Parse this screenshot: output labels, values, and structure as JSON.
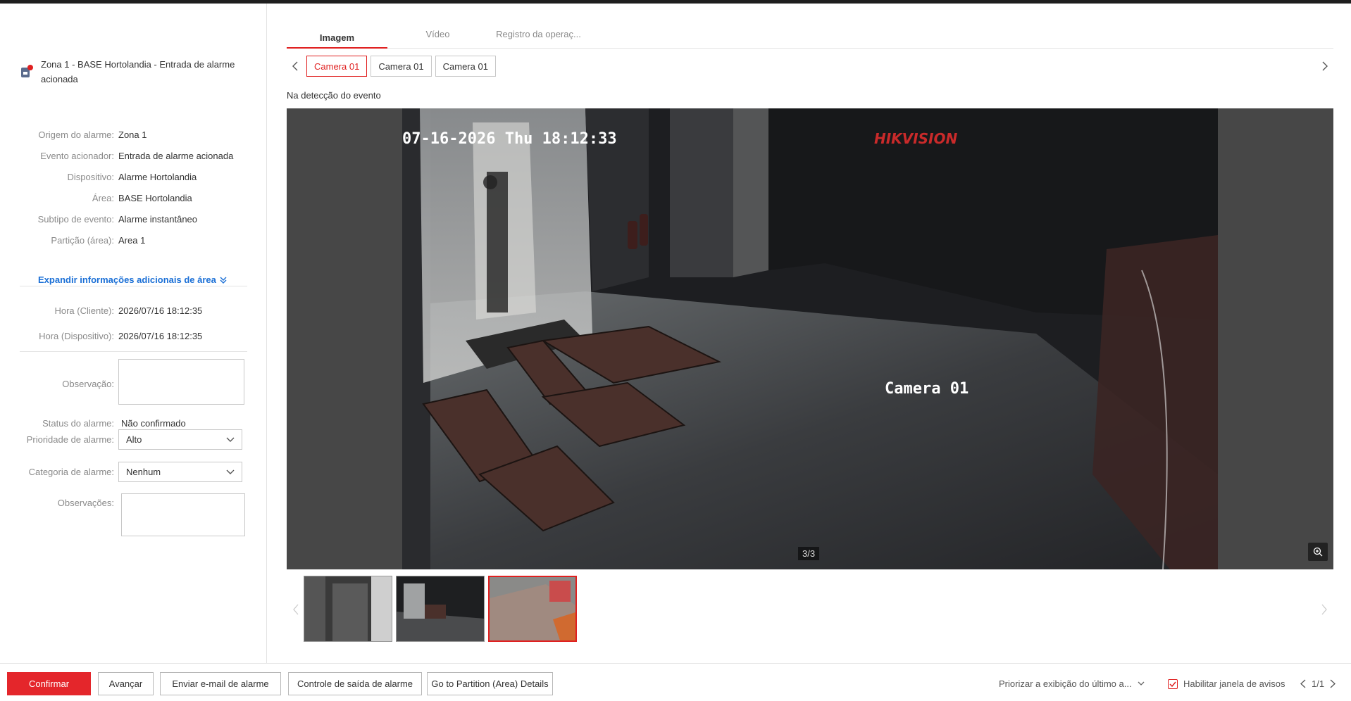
{
  "alarm": {
    "title": "Zona 1 - BASE Hortolandia - Entrada de alarme acionada"
  },
  "details": [
    {
      "label": "Origem do alarme:",
      "value": "Zona 1"
    },
    {
      "label": "Evento acionador:",
      "value": "Entrada de alarme acionada"
    },
    {
      "label": "Dispositivo:",
      "value": "Alarme Hortolandia"
    },
    {
      "label": "Área:",
      "value": "BASE Hortolandia"
    },
    {
      "label": "Subtipo de evento:",
      "value": "Alarme instantâneo"
    },
    {
      "label": "Partição (área):",
      "value": "Area 1"
    }
  ],
  "expand_link": "Expandir informações adicionais de área",
  "times": [
    {
      "label": "Hora (Cliente):",
      "value": "2026/07/16 18:12:35"
    },
    {
      "label": "Hora (Dispositivo):",
      "value": "2026/07/16 18:12:35"
    }
  ],
  "form": {
    "observacao_label": "Observação:",
    "status_label": "Status do alarme:",
    "status_value": "Não confirmado",
    "priority_label": "Prioridade de alarme:",
    "priority_value": "Alto",
    "category_label": "Categoria de alarme:",
    "category_value": "Nenhum",
    "notes_label": "Observações:"
  },
  "tabs": [
    "Imagem",
    "Vídeo",
    "Registro da operaç..."
  ],
  "cameras": [
    "Camera 01",
    "Camera 01",
    "Camera 01"
  ],
  "detection_label": "Na detecção do evento",
  "viewer": {
    "counter": "3/3",
    "osd_timestamp": "07-16-2026 Thu 18:12:33",
    "osd_brand": "HIKVISION",
    "osd_camera": "Camera 01"
  },
  "buttons": {
    "confirm": "Confirmar",
    "advance": "Avançar",
    "email": "Enviar e-mail de alarme",
    "output": "Controle de saída de alarme",
    "partition": "Go to Partition (Area) Details"
  },
  "footer": {
    "priority_display": "Priorizar a exibição do último a...",
    "enable_popup": "Habilitar janela de avisos",
    "pager": "1/1"
  },
  "colors": {
    "accent": "#e4262b",
    "link": "#1a6fd6"
  }
}
